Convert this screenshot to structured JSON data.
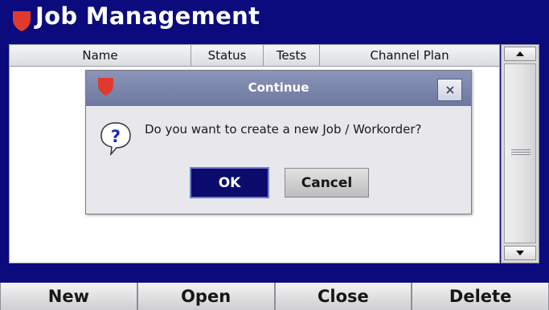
{
  "app": {
    "title": "Job Management",
    "logo_icon": "shield-icon"
  },
  "table": {
    "columns": [
      "Name",
      "Status",
      "Tests",
      "Channel Plan"
    ],
    "rows": []
  },
  "scrollbar": {
    "up_icon": "arrow-up-icon",
    "down_icon": "arrow-down-icon"
  },
  "dialog": {
    "title": "Continue",
    "close_icon": "close-icon",
    "icon": "question-icon",
    "message": "Do you want to create a new Job / Workorder?",
    "ok_label": "OK",
    "cancel_label": "Cancel"
  },
  "bottom_bar": {
    "buttons": [
      "New",
      "Open",
      "Close",
      "Delete"
    ]
  },
  "colors": {
    "brand_blue": "#0b0b7e",
    "logo_red": "#e03a2f",
    "dialog_title": "#7a84ac"
  }
}
